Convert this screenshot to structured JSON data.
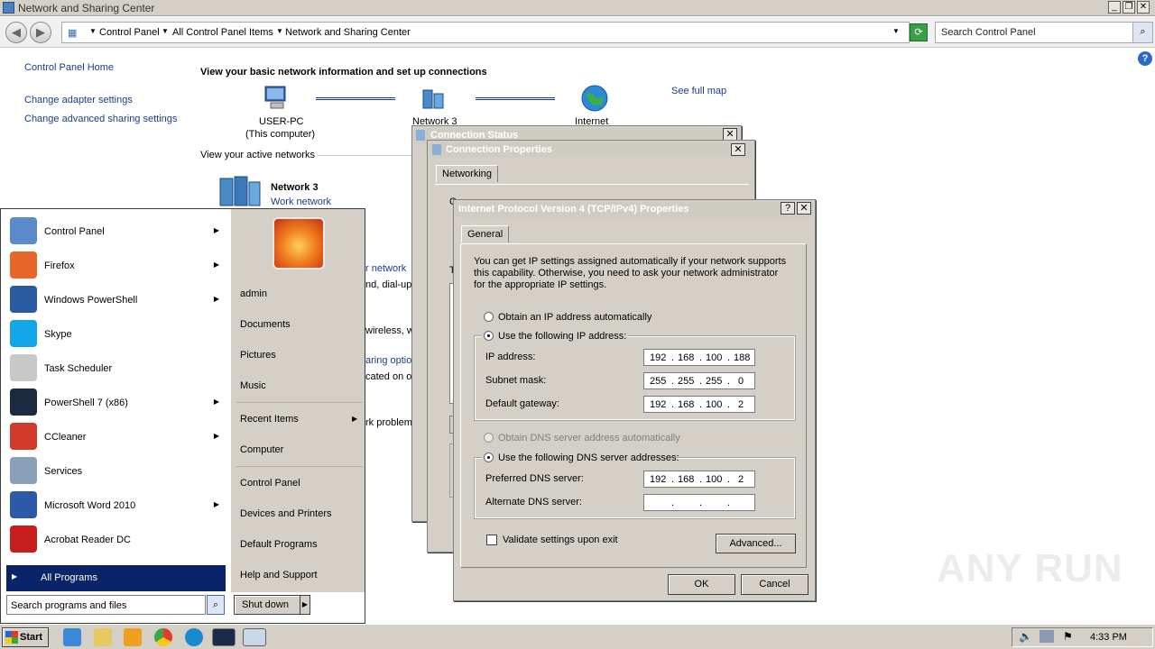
{
  "window": {
    "title": "Network and Sharing Center"
  },
  "addressbar": {
    "crumbs": [
      "Control Panel",
      "All Control Panel Items",
      "Network and Sharing Center"
    ],
    "search_placeholder": "Search Control Panel"
  },
  "sidebar": {
    "home": "Control Panel Home",
    "items": [
      "Change adapter settings",
      "Change advanced sharing settings"
    ]
  },
  "main": {
    "heading": "View your basic network information and set up connections",
    "see_full_map": "See full map",
    "nodes": [
      {
        "label": "USER-PC",
        "sub": "(This computer)"
      },
      {
        "label": "Network  3",
        "sub": ""
      },
      {
        "label": "Internet",
        "sub": ""
      }
    ],
    "active_networks_label": "View your active networks",
    "active_network_name": "Network  3",
    "active_network_type": "Work network",
    "partial_texts": [
      "r network",
      "nd, dial-up",
      "wireless, w",
      "aring optio",
      "cated on ot",
      "rk problem"
    ]
  },
  "dialogs": {
    "status_title": "Connection Status",
    "props_title": "Connection Properties",
    "props_tab": "Networking",
    "props_partial_c": "C",
    "props_partial_t": "T",
    "ipv4": {
      "title": "Internet Protocol Version 4 (TCP/IPv4) Properties",
      "help_glyph": "?",
      "tab": "General",
      "description": "You can get IP settings assigned automatically if your network supports this capability. Otherwise, you need to ask your network administrator for the appropriate IP settings.",
      "auto_ip": "Obtain an IP address automatically",
      "use_ip": "Use the following IP address:",
      "ip_label": "IP address:",
      "ip": [
        "192",
        "168",
        "100",
        "188"
      ],
      "mask_label": "Subnet mask:",
      "mask": [
        "255",
        "255",
        "255",
        "0"
      ],
      "gw_label": "Default gateway:",
      "gw": [
        "192",
        "168",
        "100",
        "2"
      ],
      "auto_dns": "Obtain DNS server address automatically",
      "use_dns": "Use the following DNS server addresses:",
      "pref_dns_label": "Preferred DNS server:",
      "pref_dns": [
        "192",
        "168",
        "100",
        "2"
      ],
      "alt_dns_label": "Alternate DNS server:",
      "alt_dns": [
        "",
        "",
        "",
        ""
      ],
      "validate": "Validate settings upon exit",
      "advanced": "Advanced...",
      "ok": "OK",
      "cancel": "Cancel"
    }
  },
  "startmenu": {
    "programs": [
      {
        "label": "Control Panel",
        "icon": "control-panel-icon",
        "arrow": true,
        "color": "#5a8ac8"
      },
      {
        "label": "Firefox",
        "icon": "firefox-icon",
        "arrow": true,
        "color": "#e8662a"
      },
      {
        "label": "Windows PowerShell",
        "icon": "powershell-icon",
        "arrow": true,
        "color": "#2a5aa0"
      },
      {
        "label": "Skype",
        "icon": "skype-icon",
        "arrow": false,
        "color": "#12a5e8"
      },
      {
        "label": "Task Scheduler",
        "icon": "clock-icon",
        "arrow": false,
        "color": "#c8c8c8"
      },
      {
        "label": "PowerShell 7 (x86)",
        "icon": "powershell7-icon",
        "arrow": true,
        "color": "#1a2a40"
      },
      {
        "label": "CCleaner",
        "icon": "ccleaner-icon",
        "arrow": true,
        "color": "#d03a2a"
      },
      {
        "label": "Services",
        "icon": "gears-icon",
        "arrow": false,
        "color": "#8aa0b8"
      },
      {
        "label": "Microsoft Word 2010",
        "icon": "word-icon",
        "arrow": true,
        "color": "#2a5aa8"
      },
      {
        "label": "Acrobat Reader DC",
        "icon": "acrobat-icon",
        "arrow": false,
        "color": "#c81e1e"
      }
    ],
    "all_programs": "All Programs",
    "search_placeholder": "Search programs and files",
    "right_items": [
      "admin",
      "Documents",
      "Pictures",
      "Music",
      "Recent Items",
      "Computer",
      "Control Panel",
      "Devices and Printers",
      "Default Programs",
      "Help and Support"
    ],
    "shutdown": "Shut down"
  },
  "taskbar": {
    "start": "Start",
    "clock": "4:33 PM"
  },
  "watermark": "ANY RUN"
}
